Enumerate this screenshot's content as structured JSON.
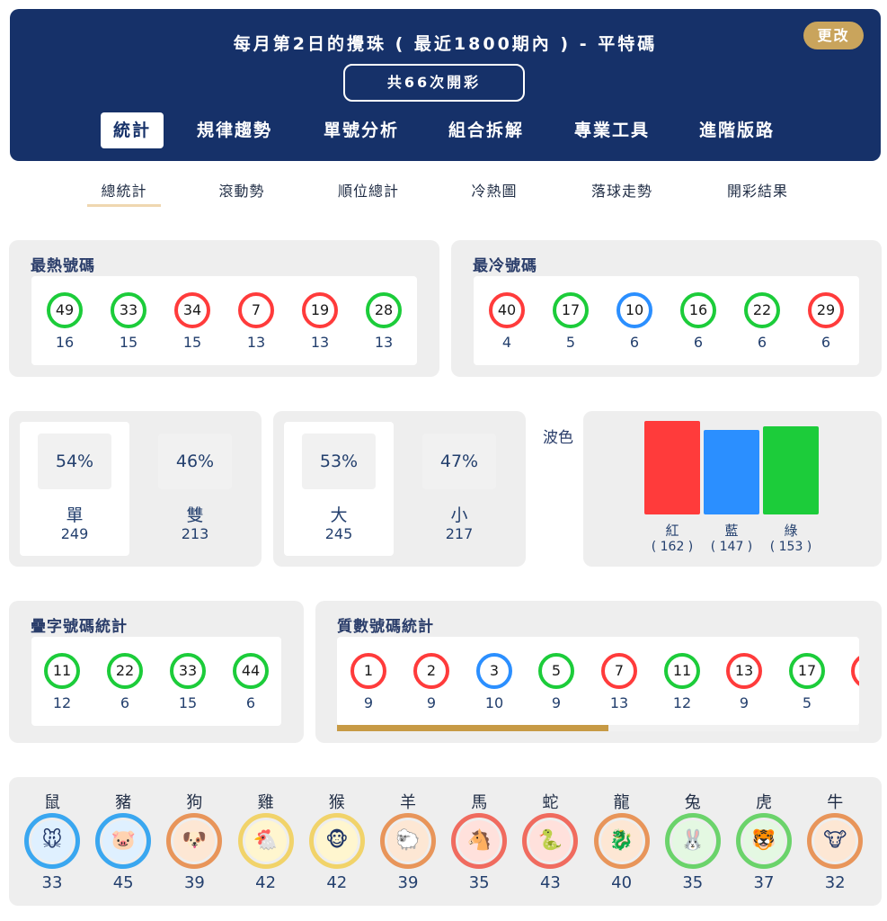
{
  "header": {
    "title": "每月第2日的攪珠 ( 最近1800期內 ) - 平特碼",
    "change_label": "更改",
    "count_label": "共66次開彩"
  },
  "nav_tabs": [
    "統計",
    "規律趨勢",
    "單號分析",
    "組合拆解",
    "專業工具",
    "進階版路"
  ],
  "active_nav_tab": "統計",
  "sub_tabs": [
    "總統計",
    "滾動勢",
    "順位總計",
    "冷熱圖",
    "落球走勢",
    "開彩結果"
  ],
  "active_sub_tab": "總統計",
  "colors": {
    "red": "#ff3b3b",
    "green": "#1ccc3a",
    "blue": "#2b8fff",
    "navy": "#163169",
    "gold": "#c9a45c"
  },
  "hot": {
    "title": "最熱號碼",
    "balls": [
      {
        "num": "49",
        "color": "green",
        "count": "16"
      },
      {
        "num": "33",
        "color": "green",
        "count": "15"
      },
      {
        "num": "34",
        "color": "red",
        "count": "15"
      },
      {
        "num": "7",
        "color": "red",
        "count": "13"
      },
      {
        "num": "19",
        "color": "red",
        "count": "13"
      },
      {
        "num": "28",
        "color": "green",
        "count": "13"
      }
    ]
  },
  "cold": {
    "title": "最冷號碼",
    "balls": [
      {
        "num": "40",
        "color": "red",
        "count": "4"
      },
      {
        "num": "17",
        "color": "green",
        "count": "5"
      },
      {
        "num": "10",
        "color": "blue",
        "count": "6"
      },
      {
        "num": "16",
        "color": "green",
        "count": "6"
      },
      {
        "num": "22",
        "color": "green",
        "count": "6"
      },
      {
        "num": "29",
        "color": "red",
        "count": "6"
      }
    ]
  },
  "odd_even": [
    {
      "pct": "54%",
      "label": "單",
      "value": "249"
    },
    {
      "pct": "46%",
      "label": "雙",
      "value": "213"
    }
  ],
  "big_small": [
    {
      "pct": "53%",
      "label": "大",
      "value": "245"
    },
    {
      "pct": "47%",
      "label": "小",
      "value": "217"
    }
  ],
  "wave": {
    "title": "波色",
    "bars": [
      {
        "label": "紅",
        "value": 162,
        "value_text": "( 162 )",
        "color": "#ff3b3b"
      },
      {
        "label": "藍",
        "value": 147,
        "value_text": "( 147 )",
        "color": "#2b8fff"
      },
      {
        "label": "綠",
        "value": 153,
        "value_text": "( 153 )",
        "color": "#1ccc3a"
      }
    ]
  },
  "double_digit": {
    "title": "疊字號碼統計",
    "balls": [
      {
        "num": "11",
        "color": "green",
        "count": "12"
      },
      {
        "num": "22",
        "color": "green",
        "count": "6"
      },
      {
        "num": "33",
        "color": "green",
        "count": "15"
      },
      {
        "num": "44",
        "color": "green",
        "count": "6"
      }
    ]
  },
  "prime": {
    "title": "質數號碼統計",
    "scroll_fraction": 0.52,
    "balls": [
      {
        "num": "1",
        "color": "red",
        "count": "9"
      },
      {
        "num": "2",
        "color": "red",
        "count": "9"
      },
      {
        "num": "3",
        "color": "blue",
        "count": "10"
      },
      {
        "num": "5",
        "color": "green",
        "count": "9"
      },
      {
        "num": "7",
        "color": "red",
        "count": "13"
      },
      {
        "num": "11",
        "color": "green",
        "count": "12"
      },
      {
        "num": "13",
        "color": "red",
        "count": "9"
      },
      {
        "num": "17",
        "color": "green",
        "count": "5"
      }
    ]
  },
  "zodiac": [
    {
      "name": "鼠",
      "count": "33",
      "icon": "rat-icon",
      "ring": "#3aa7f0",
      "fill": "#dff0ff",
      "glyph": "🐭"
    },
    {
      "name": "豬",
      "count": "45",
      "icon": "pig-icon",
      "ring": "#3aa7f0",
      "fill": "#dff0ff",
      "glyph": "🐷"
    },
    {
      "name": "狗",
      "count": "39",
      "icon": "dog-icon",
      "ring": "#e8955a",
      "fill": "#fde7d4",
      "glyph": "🐶"
    },
    {
      "name": "雞",
      "count": "42",
      "icon": "rooster-icon",
      "ring": "#f1d36a",
      "fill": "#fff6cf",
      "glyph": "🐔"
    },
    {
      "name": "猴",
      "count": "42",
      "icon": "monkey-icon",
      "ring": "#f1d36a",
      "fill": "#fff6cf",
      "glyph": "🐵"
    },
    {
      "name": "羊",
      "count": "39",
      "icon": "goat-icon",
      "ring": "#e8955a",
      "fill": "#fde7d4",
      "glyph": "🐑"
    },
    {
      "name": "馬",
      "count": "35",
      "icon": "horse-icon",
      "ring": "#f06b5f",
      "fill": "#ffe1dc",
      "glyph": "🐴"
    },
    {
      "name": "蛇",
      "count": "43",
      "icon": "snake-icon",
      "ring": "#f06b5f",
      "fill": "#ffe1dc",
      "glyph": "🐍"
    },
    {
      "name": "龍",
      "count": "40",
      "icon": "dragon-icon",
      "ring": "#e8955a",
      "fill": "#fde7d4",
      "glyph": "🐉"
    },
    {
      "name": "兔",
      "count": "35",
      "icon": "rabbit-icon",
      "ring": "#6bd36b",
      "fill": "#e4f8e2",
      "glyph": "🐰"
    },
    {
      "name": "虎",
      "count": "37",
      "icon": "tiger-icon",
      "ring": "#6bd36b",
      "fill": "#e4f8e2",
      "glyph": "🐯"
    },
    {
      "name": "牛",
      "count": "32",
      "icon": "ox-icon",
      "ring": "#e8955a",
      "fill": "#fde7d4",
      "glyph": "🐮"
    }
  ]
}
